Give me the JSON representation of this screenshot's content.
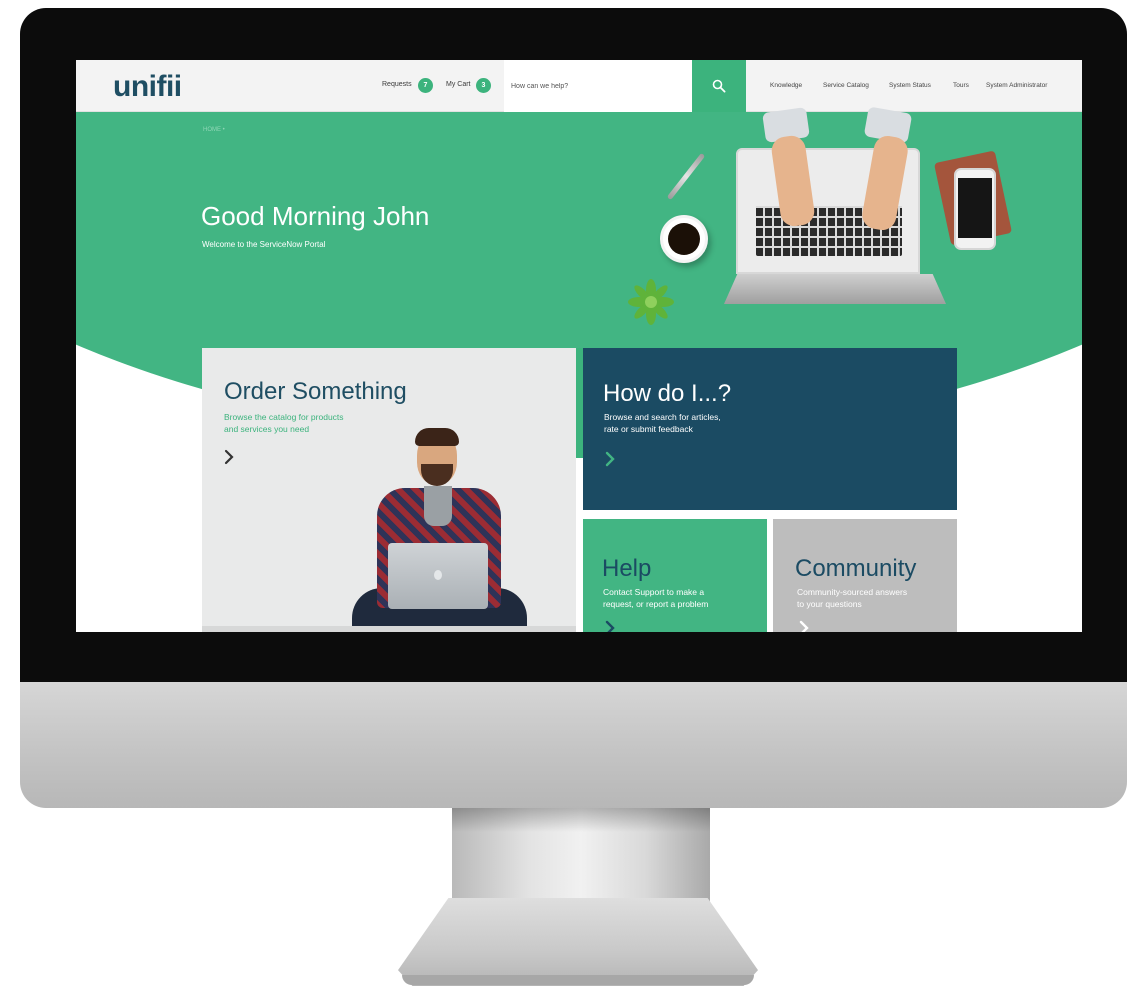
{
  "header": {
    "logo": "unifii",
    "requests_label": "Requests",
    "requests_count": "7",
    "cart_label": "My Cart",
    "cart_count": "3",
    "search_placeholder": "How can we help?",
    "nav": [
      "Knowledge",
      "Service Catalog",
      "System Status",
      "Tours",
      "System Administrator"
    ]
  },
  "hero": {
    "breadcrumb": "HOME  •",
    "greeting": "Good Morning John",
    "subtitle": "Welcome to the ServiceNow Portal"
  },
  "tiles": {
    "order": {
      "title": "Order Something",
      "desc_line1": "Browse the catalog for products",
      "desc_line2": "and services you need"
    },
    "how": {
      "title": "How do I...?",
      "desc_line1": "Browse and search for articles,",
      "desc_line2": "rate or submit feedback"
    },
    "help": {
      "title": "Help",
      "desc_line1": "Contact Support to make a",
      "desc_line2": "request, or report a problem"
    },
    "community": {
      "title": "Community",
      "desc_line1": "Community-sourced answers",
      "desc_line2": "to your questions"
    }
  },
  "colors": {
    "accent_green": "#42b583",
    "navy": "#1b4b63",
    "logo": "#1f4e63",
    "community_gray": "#bdbdbd"
  },
  "icons": {
    "search": "search-icon",
    "chevron": "chevron-right-icon"
  }
}
